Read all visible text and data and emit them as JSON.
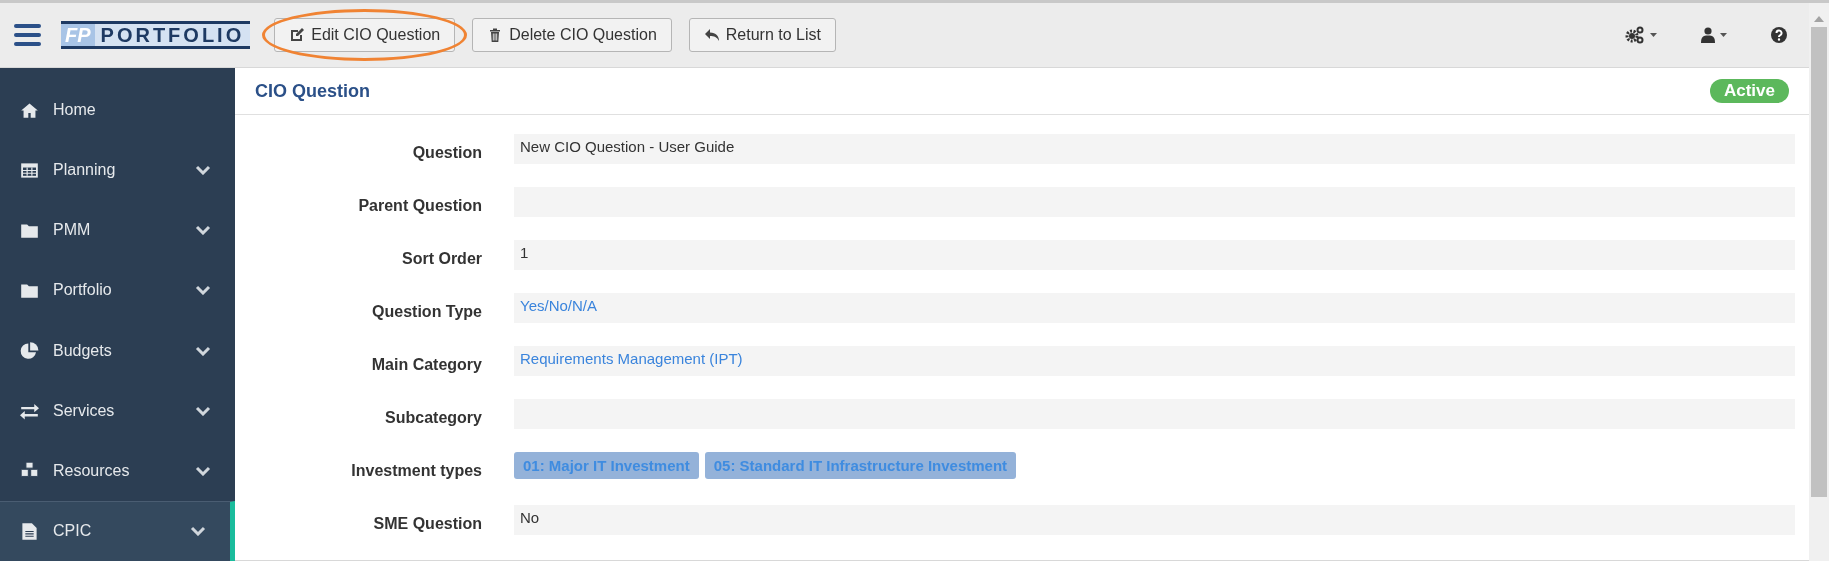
{
  "toolbar": {
    "logo": {
      "prefix": "FP",
      "name": "PORTFOLIO"
    },
    "buttons": [
      {
        "label": "Edit CIO Question",
        "kind": "edit",
        "highlighted": true
      },
      {
        "label": "Delete CIO Question",
        "kind": "trash",
        "highlighted": false
      },
      {
        "label": "Return to List",
        "kind": "reply",
        "highlighted": false
      }
    ]
  },
  "sidebar": {
    "items": [
      {
        "label": "Home",
        "kind": "home",
        "expandable": false,
        "selected": false
      },
      {
        "label": "Planning",
        "kind": "table",
        "expandable": true,
        "selected": false
      },
      {
        "label": "PMM",
        "kind": "folder",
        "expandable": true,
        "selected": false
      },
      {
        "label": "Portfolio",
        "kind": "folder",
        "expandable": true,
        "selected": false
      },
      {
        "label": "Budgets",
        "kind": "pie",
        "expandable": true,
        "selected": false
      },
      {
        "label": "Services",
        "kind": "exchange",
        "expandable": true,
        "selected": false
      },
      {
        "label": "Resources",
        "kind": "cubes",
        "expandable": true,
        "selected": false
      },
      {
        "label": "CPIC",
        "kind": "file",
        "expandable": true,
        "selected": true
      }
    ]
  },
  "panel": {
    "title": "CIO Question",
    "status": "Active",
    "fields": [
      {
        "label": "Question",
        "kind": "text",
        "value": "New CIO Question - User Guide"
      },
      {
        "label": "Parent Question",
        "kind": "text"
      },
      {
        "label": "Sort Order",
        "kind": "text",
        "value": "1"
      },
      {
        "label": "Question Type",
        "kind": "link",
        "value": "Yes/No/N/A"
      },
      {
        "label": "Main Category",
        "kind": "link",
        "value": "Requirements Management (IPT)"
      },
      {
        "label": "Subcategory",
        "kind": "text"
      },
      {
        "label": "Investment types",
        "kind": "tags",
        "tags": [
          "01: Major IT Investment",
          "05: Standard IT Infrastructure Investment"
        ]
      },
      {
        "label": "SME Question",
        "kind": "text",
        "value": "No"
      }
    ]
  }
}
